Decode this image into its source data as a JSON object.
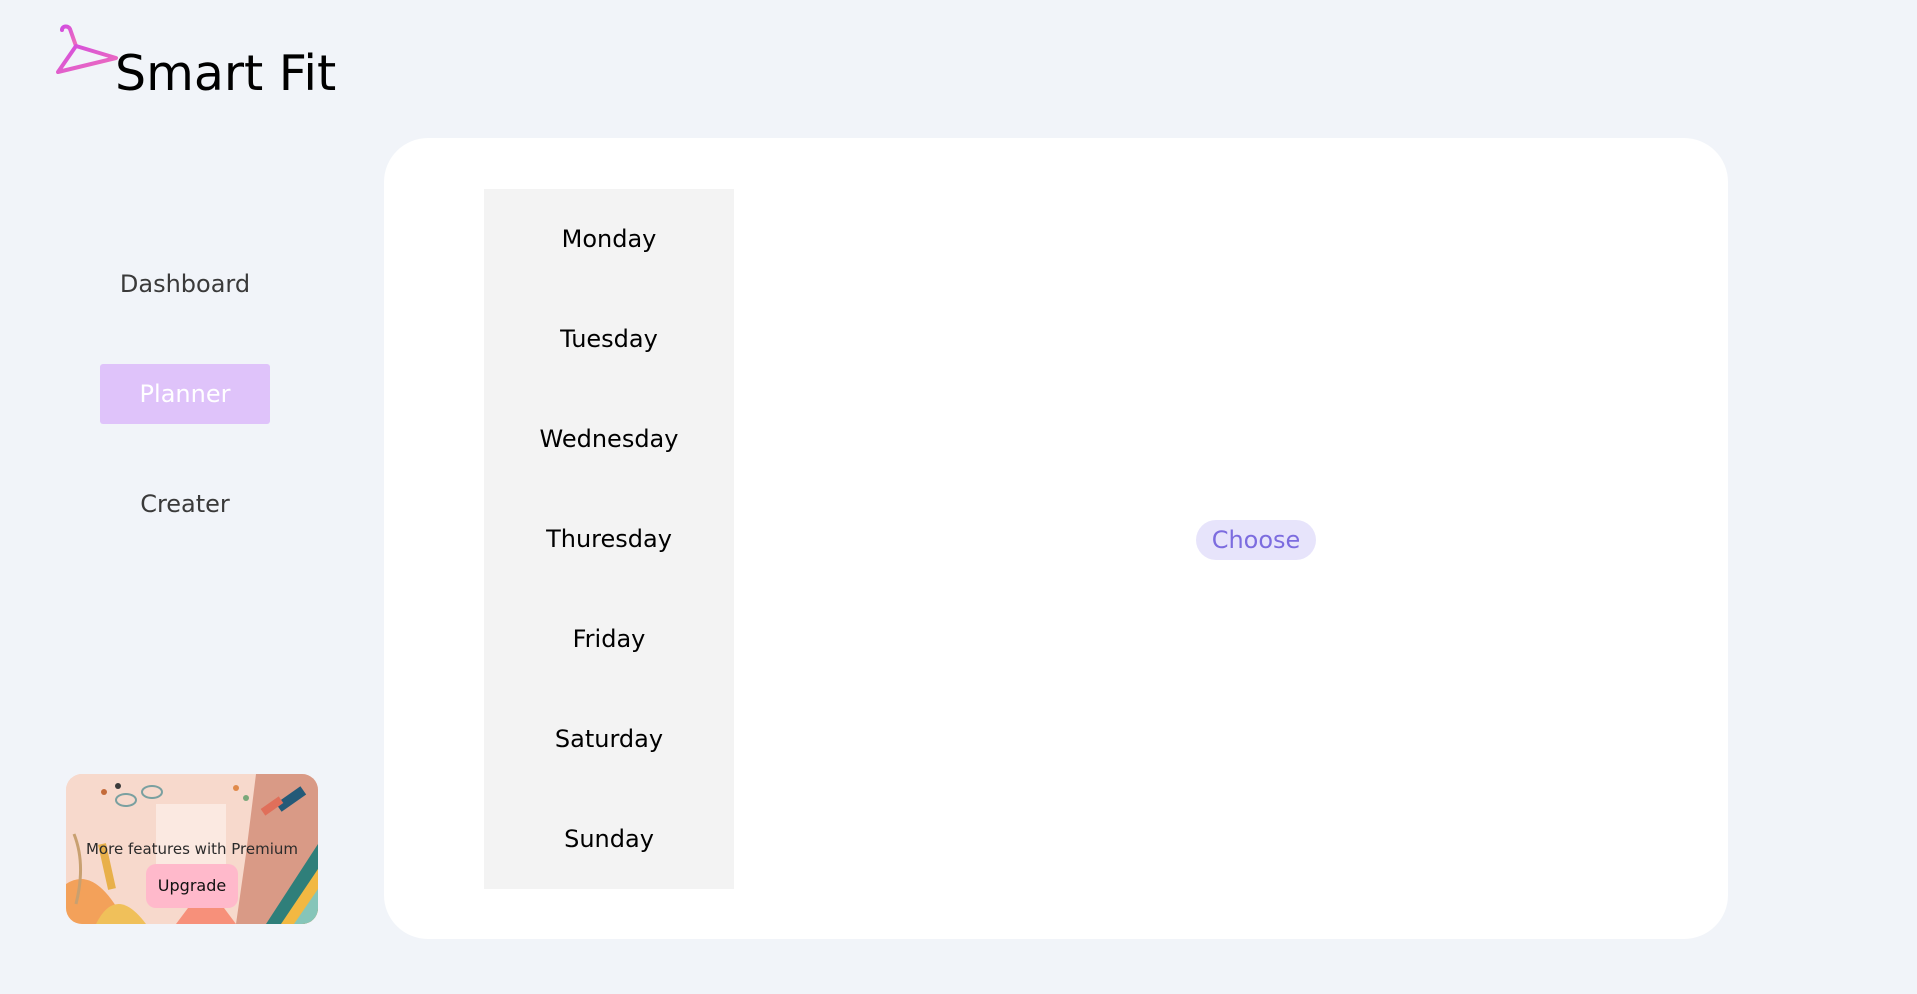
{
  "app": {
    "title": "Smart Fit",
    "logo_icon": "hanger-icon"
  },
  "nav": {
    "items": [
      {
        "label": "Dashboard",
        "active": false
      },
      {
        "label": "Planner",
        "active": true
      },
      {
        "label": "Creater",
        "active": false
      }
    ],
    "active_color": "#dfc3fa"
  },
  "promo": {
    "text": "More features with Premium",
    "button_label": "Upgrade",
    "button_color": "#ffb9cb"
  },
  "planner": {
    "days": [
      "Monday",
      "Tuesday",
      "Wednesday",
      "Thuresday",
      "Friday",
      "Saturday",
      "Sunday"
    ],
    "choose_label": "Choose",
    "accent_color": "#7c6cdf"
  }
}
